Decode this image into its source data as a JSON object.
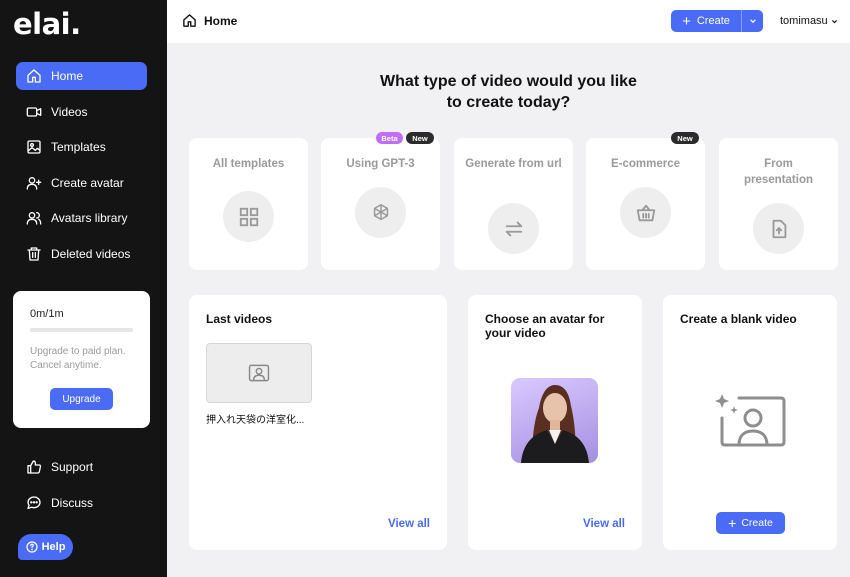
{
  "brand": {
    "logo": "elai."
  },
  "sidebar": {
    "items": [
      {
        "label": "Home",
        "icon": "home-icon",
        "active": true
      },
      {
        "label": "Videos",
        "icon": "video-camera-icon"
      },
      {
        "label": "Templates",
        "icon": "image-icon"
      },
      {
        "label": "Create avatar",
        "icon": "user-plus-icon"
      },
      {
        "label": "Avatars library",
        "icon": "users-icon"
      },
      {
        "label": "Deleted videos",
        "icon": "trash-icon"
      }
    ],
    "plan": {
      "usage": "0m/1m",
      "progress_percent": 0,
      "text": "Upgrade to paid plan. Cancel anytime.",
      "upgrade_label": "Upgrade"
    },
    "bottom_items": [
      {
        "label": "Support",
        "icon": "thumbs-up-icon"
      },
      {
        "label": "Discuss",
        "icon": "chat-bubble-icon"
      }
    ],
    "help_label": "Help"
  },
  "topbar": {
    "title": "Home",
    "create_label": "Create",
    "user": "tomimasu"
  },
  "main": {
    "headline_line1": "What type of video would you like",
    "headline_line2": "to create today?",
    "categories": [
      {
        "label": "All templates",
        "icon": "grid-icon"
      },
      {
        "label": "Using GPT-3",
        "icon": "openai-icon",
        "badges": [
          "Beta",
          "New"
        ]
      },
      {
        "label": "Generate from url",
        "icon": "swap-arrows-icon"
      },
      {
        "label": "E-commerce",
        "icon": "basket-icon",
        "badges": [
          "New"
        ]
      },
      {
        "label": "From presentation",
        "icon": "file-upload-icon"
      }
    ],
    "last_videos": {
      "title": "Last videos",
      "item_caption": "押入れ天袋の洋室化...",
      "view_all": "View all"
    },
    "avatar_panel": {
      "title": "Choose an avatar for your video",
      "view_all": "View all"
    },
    "blank_panel": {
      "title": "Create a blank video",
      "create_label": "Create"
    }
  },
  "colors": {
    "accent": "#4a6bf5",
    "sidebar_bg": "#141414",
    "beta_badge": "#c16ef7",
    "new_badge": "#2b2b2b"
  }
}
